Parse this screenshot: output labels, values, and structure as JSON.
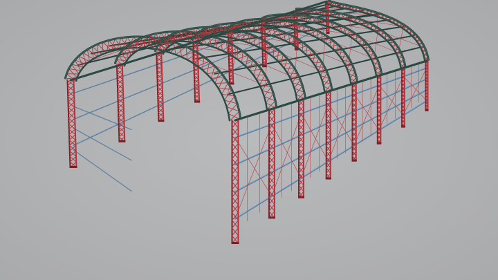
{
  "scene": {
    "background_color": "#b0b1b3",
    "model_name": "arched-steel-truss-hangar-frame",
    "bays": 7,
    "colors": {
      "column_truss": "#b7323b",
      "column_truss_dark": "#7c1e25",
      "arch_chord": "#2c4a44",
      "arch_chord_light": "#3f6159",
      "arch_web": "#a83a3e",
      "purlin": "#27403b",
      "side_rail": "#5b7fa0",
      "side_rail_light": "#8fb3cf",
      "bracing": "#b8484c"
    }
  }
}
